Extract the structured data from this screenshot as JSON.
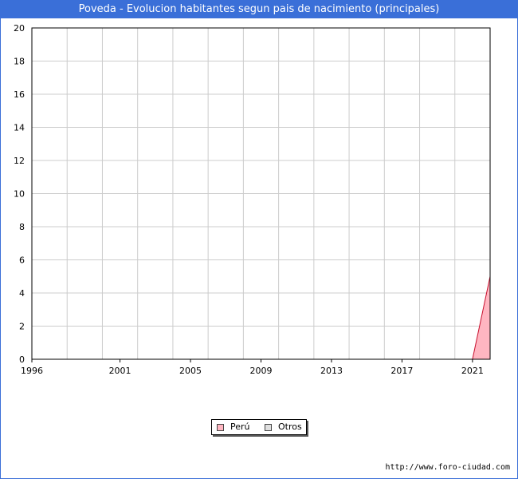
{
  "title": "Poveda - Evolucion habitantes segun pais de nacimiento (principales)",
  "source": "http://www.foro-ciudad.com",
  "colors": {
    "accent": "#3a6fd8",
    "peru_fill": "#ffb6c1",
    "peru_line": "#c8102e",
    "otros_fill": "#e0e0e0",
    "grid": "#cccccc"
  },
  "chart_data": {
    "type": "area",
    "title": "Poveda - Evolucion habitantes segun pais de nacimiento (principales)",
    "xlabel": "",
    "ylabel": "",
    "xlim": [
      1996,
      2022
    ],
    "ylim": [
      0,
      20
    ],
    "grid": true,
    "legend_position": "bottom-center",
    "x_ticks": [
      1996,
      2001,
      2005,
      2009,
      2013,
      2017,
      2021
    ],
    "y_ticks": [
      0,
      2,
      4,
      6,
      8,
      10,
      12,
      14,
      16,
      18,
      20
    ],
    "series": [
      {
        "name": "Perú",
        "x": [
          2021,
          2022
        ],
        "values": [
          0,
          5
        ]
      },
      {
        "name": "Otros",
        "x": [],
        "values": []
      }
    ]
  }
}
